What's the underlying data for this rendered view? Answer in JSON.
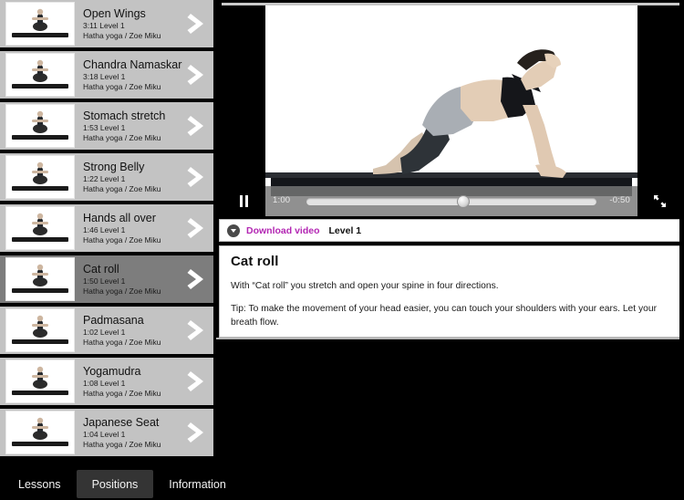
{
  "app": {
    "accent_magenta": "#b327b3",
    "list_bg": "#c3c3c3",
    "list_selected_bg": "#7d7d7d",
    "panel_bg": "#000000"
  },
  "sidebar": {
    "name": "positions-list",
    "items": [
      {
        "title": "",
        "duration": "",
        "level": "",
        "style": "",
        "partial": true,
        "selected": false
      },
      {
        "title": "Open Wings",
        "duration": "3:11",
        "level": "Level 1",
        "style": "Hatha yoga / Zoe Miku",
        "selected": false
      },
      {
        "title": "Chandra Namaskar",
        "duration": "3:18",
        "level": "Level 1",
        "style": "Hatha yoga / Zoe Miku",
        "selected": false
      },
      {
        "title": "Stomach stretch",
        "duration": "1:53",
        "level": "Level 1",
        "style": "Hatha yoga / Zoe Miku",
        "selected": false
      },
      {
        "title": "Strong Belly",
        "duration": "1:22",
        "level": "Level 1",
        "style": "Hatha yoga / Zoe Miku",
        "selected": false
      },
      {
        "title": "Hands all over",
        "duration": "1:46",
        "level": "Level 1",
        "style": "Hatha yoga / Zoe Miku",
        "selected": false
      },
      {
        "title": "Cat roll",
        "duration": "1:50",
        "level": "Level 1",
        "style": "Hatha yoga / Zoe Miku",
        "selected": true
      },
      {
        "title": "Padmasana",
        "duration": "1:02",
        "level": "Level 1",
        "style": "Hatha yoga / Zoe Miku",
        "selected": false
      },
      {
        "title": "Yogamudra",
        "duration": "1:08",
        "level": "Level 1",
        "style": "Hatha yoga / Zoe Miku",
        "selected": false
      },
      {
        "title": "Japanese Seat",
        "duration": "1:04",
        "level": "Level 1",
        "style": "Hatha yoga / Zoe Miku",
        "selected": false
      }
    ]
  },
  "player": {
    "pause_icon": "pause-icon",
    "fullscreen_icon": "fullscreen-icon",
    "elapsed": "1:00",
    "remaining": "-0:50",
    "progress_percent": 54
  },
  "download": {
    "icon": "download-circle-icon",
    "label": "Download video",
    "level": "Level 1"
  },
  "detail": {
    "title": "Cat roll",
    "paragraph1": "With “Cat roll” you stretch and open your spine in four directions.",
    "paragraph2": "Tip: To make the movement of your head easier, you can touch your shoulders with your ears. Let your breath flow."
  },
  "tabs": [
    {
      "label": "Lessons",
      "active": false
    },
    {
      "label": "Positions",
      "active": true
    },
    {
      "label": "Information",
      "active": false
    }
  ]
}
